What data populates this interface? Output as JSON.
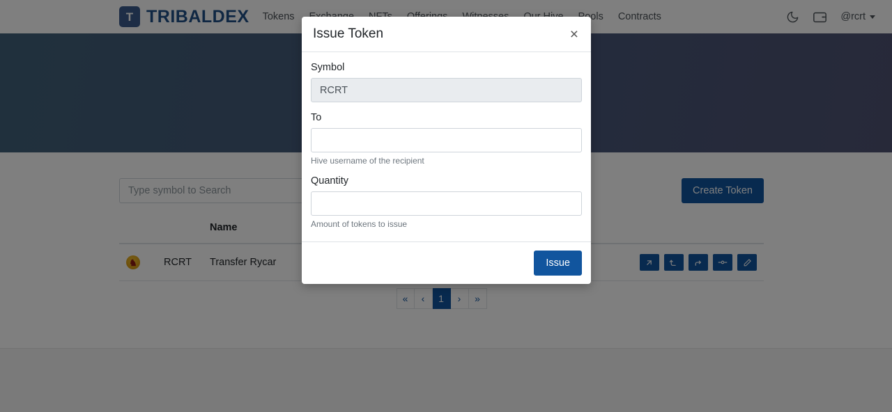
{
  "navbar": {
    "brand_initial": "T",
    "brand_name": "TRIBALDEX",
    "links": [
      {
        "label": "Tokens"
      },
      {
        "label": "Exchange"
      },
      {
        "label": "NFTs"
      },
      {
        "label": "Offerings"
      },
      {
        "label": "Witnesses"
      },
      {
        "label": "Our Hive"
      },
      {
        "label": "Pools"
      },
      {
        "label": "Contracts"
      }
    ],
    "theme_toggle_icon": "moon-icon",
    "wallet_icon": "wallet-icon",
    "username": "@rcrt"
  },
  "toolbar": {
    "search_placeholder": "Type symbol to Search",
    "search_value": "",
    "create_token_label": "Create Token"
  },
  "table": {
    "headers": {
      "icon": "",
      "symbol": "",
      "name": "Name",
      "actions": ""
    },
    "rows": [
      {
        "emblem": "token-emblem-icon",
        "symbol": "RCRT",
        "name": "Transfer Rycar",
        "actions": [
          {
            "name": "issue-token-action",
            "icon": "arrow-up-right-icon"
          },
          {
            "name": "transfer-token-action",
            "icon": "arrow-up-left-icon"
          },
          {
            "name": "delegate-token-action",
            "icon": "arrow-redo-icon"
          },
          {
            "name": "stake-token-action",
            "icon": "node-link-icon"
          },
          {
            "name": "edit-token-action",
            "icon": "pencil-icon"
          }
        ]
      }
    ]
  },
  "pagination": {
    "first_label": "«",
    "prev_label": "‹",
    "pages": [
      "1"
    ],
    "next_label": "›",
    "last_label": "»",
    "active_page": "1"
  },
  "modal": {
    "title": "Issue Token",
    "close_label": "×",
    "fields": {
      "symbol": {
        "label": "Symbol",
        "value": "RCRT",
        "placeholder": "",
        "help": ""
      },
      "to": {
        "label": "To",
        "value": "",
        "placeholder": "",
        "help": "Hive username of the recipient"
      },
      "quantity": {
        "label": "Quantity",
        "value": "",
        "placeholder": "",
        "help": "Amount of tokens to issue"
      }
    },
    "submit_label": "Issue"
  },
  "colors": {
    "brand_blue": "#1f4e87",
    "accent_blue": "#11559e",
    "hero_gradient_start": "#41617a",
    "hero_gradient_end": "#4f5373",
    "token_gold": "#d89a14"
  }
}
